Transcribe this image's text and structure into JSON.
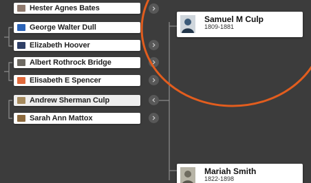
{
  "tree": {
    "people": [
      {
        "name": "Hester Agnes Bates",
        "photo_color": "#8f7a6e"
      },
      {
        "name": "George Walter Dull",
        "photo_color": "#2b63b7"
      },
      {
        "name": "Elizabeth Hoover",
        "photo_color": "#2f3f66"
      },
      {
        "name": "Albert Rothrock Bridge",
        "photo_color": "#6e6a63"
      },
      {
        "name": "Elisabeth E Spencer",
        "photo_color": "#e06a3c"
      },
      {
        "name": "Andrew Sherman Culp",
        "photo_color": "#a58a5e"
      },
      {
        "name": "Sarah Ann Mattox",
        "photo_color": "#8c6a3e"
      }
    ],
    "focus_person": {
      "name": "Samuel M Culp",
      "dates": "1809-1881",
      "photo_color": "#3b5a78"
    },
    "spouse": {
      "name": "Mariah Smith",
      "dates": "1822-1898",
      "photo_color": "#9a9a8e"
    }
  },
  "colors": {
    "background": "#3c3c3c",
    "line": "#8e8e8e",
    "annotation_circle": "#e25d1e"
  },
  "icons": {
    "expand": "chevron-right-icon",
    "collapse": "chevron-left-icon"
  }
}
